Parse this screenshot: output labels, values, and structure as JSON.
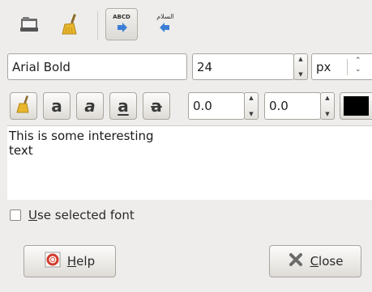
{
  "toolbar": {
    "items": [
      {
        "name": "folder-icon"
      },
      {
        "name": "clean-icon"
      },
      {
        "name": "ltr-direction-icon",
        "label": "ABCD"
      },
      {
        "name": "rtl-direction-icon",
        "label": "السلام"
      }
    ]
  },
  "font": {
    "family_value": "Arial Bold",
    "size_value": "24",
    "unit_value": "px"
  },
  "style_row": {
    "buttons": [
      {
        "name": "clear-style-button",
        "icon": "broom-icon"
      },
      {
        "name": "bold-button",
        "glyph": "a"
      },
      {
        "name": "italic-button",
        "glyph": "a"
      },
      {
        "name": "underline-button",
        "glyph": "a"
      },
      {
        "name": "strikethrough-button",
        "glyph": "a"
      }
    ],
    "baseline_value": "0.0",
    "kerning_value": "0.0",
    "color": "#000000"
  },
  "editor": {
    "text": "This is some interesting\ntext"
  },
  "use_selected_font": {
    "label_first": "U",
    "label_rest": "se selected font",
    "checked": false
  },
  "buttons": {
    "help_first": "H",
    "help_rest": "elp",
    "close_first": "C",
    "close_rest": "lose"
  },
  "colors": {
    "background": "#eeedeb",
    "accent": "#3b7fd4"
  }
}
